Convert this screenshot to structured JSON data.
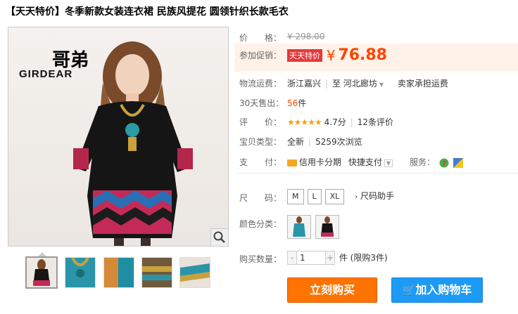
{
  "title": "【天天特价】冬季新款女装连衣裙 民族风提花 圆领针织长款毛衣",
  "brand": {
    "logo_text": "GIRDEAR",
    "logo_mark": "哥弟"
  },
  "price": {
    "label": "价　　格：",
    "original": "¥ 298.00"
  },
  "promo": {
    "label": "参加促销：",
    "badge": "天天特价",
    "currency": "¥",
    "price": "76.88"
  },
  "shipping": {
    "label": "物流运费：",
    "from": "浙江嘉兴",
    "to": "至  河北廊坊",
    "fee": "卖家承担运费"
  },
  "sales": {
    "label": "30天售出：",
    "count": "56",
    "unit": "件"
  },
  "rating": {
    "label": "评　　价：",
    "stars": "★★★★★",
    "score": "4.7分",
    "reviews": "12条评价"
  },
  "item_type": {
    "label": "宝贝类型：",
    "condition": "全新",
    "views": "5259次浏览"
  },
  "payment": {
    "label": "支　　付：",
    "method": "信用卡分期",
    "quick": "快捷支付",
    "service_label": "服务："
  },
  "size": {
    "label": "尺　　码：",
    "options": [
      "M",
      "L",
      "XL"
    ],
    "helper": "尺码助手"
  },
  "color": {
    "label": "颜色分类："
  },
  "quantity": {
    "label": "购买数量：",
    "value": "1",
    "minus": "-",
    "plus": "+",
    "suffix": "件 (限购3件)"
  },
  "buttons": {
    "buy": "立刻购买",
    "cart": "加入购物车"
  },
  "colors": {
    "accent": "#ff4400",
    "buy_bg": "#ff7300",
    "cart_bg": "#1c9af6",
    "badge_bg": "#e4393c"
  }
}
